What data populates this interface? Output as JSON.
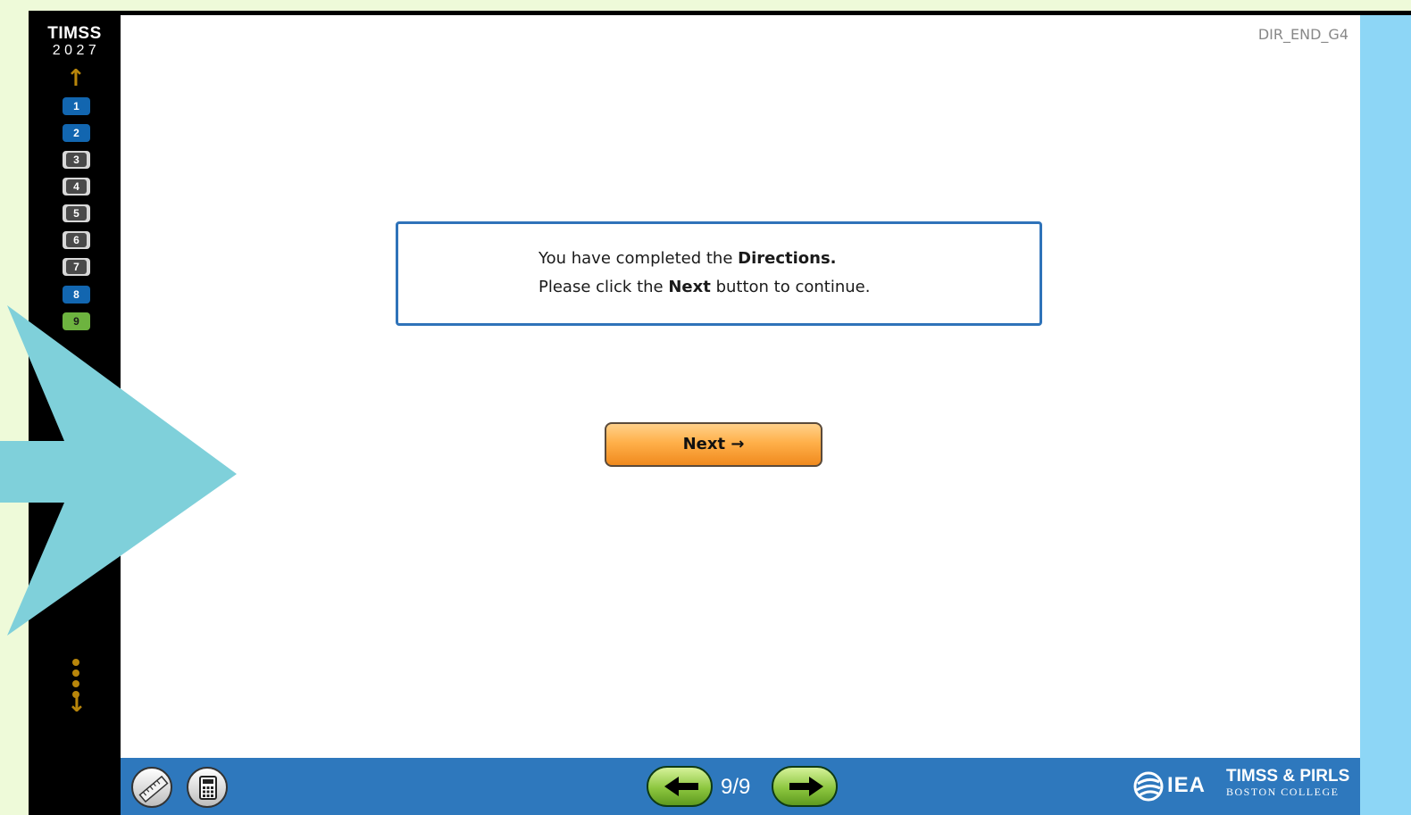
{
  "logo": {
    "line1": "TIMSS",
    "line2": "2027"
  },
  "nav": {
    "items": [
      {
        "label": "1",
        "state": "blue"
      },
      {
        "label": "2",
        "state": "blue"
      },
      {
        "label": "3",
        "state": "grey"
      },
      {
        "label": "4",
        "state": "grey"
      },
      {
        "label": "5",
        "state": "grey"
      },
      {
        "label": "6",
        "state": "grey"
      },
      {
        "label": "7",
        "state": "grey"
      },
      {
        "label": "8",
        "state": "blue"
      },
      {
        "label": "9",
        "state": "current"
      }
    ]
  },
  "screen_code": "DIR_END_G4",
  "message": {
    "line1_pre": "You have completed the ",
    "line1_bold": "Directions.",
    "line2_pre": "Please click the ",
    "line2_bold": "Next",
    "line2_post": " button to continue."
  },
  "next_button": {
    "label": "Next →"
  },
  "footer": {
    "page_counter": "9/9",
    "iea_label": "IEA",
    "brand_line1": "TIMSS & PIRLS",
    "brand_line2": "BOSTON COLLEGE"
  },
  "colors": {
    "background": "#eefad9",
    "bar_blue": "#2e78bd",
    "accent_orange": "#ffb04a",
    "pointer_arrow": "#7fd0da",
    "right_strip": "#8dd6f6"
  },
  "icons": {
    "ruler": "ruler-icon",
    "calculator": "calculator-icon",
    "back": "arrow-left-icon",
    "forward": "arrow-right-icon",
    "up": "arrow-up-icon",
    "down": "arrow-down-icon"
  }
}
